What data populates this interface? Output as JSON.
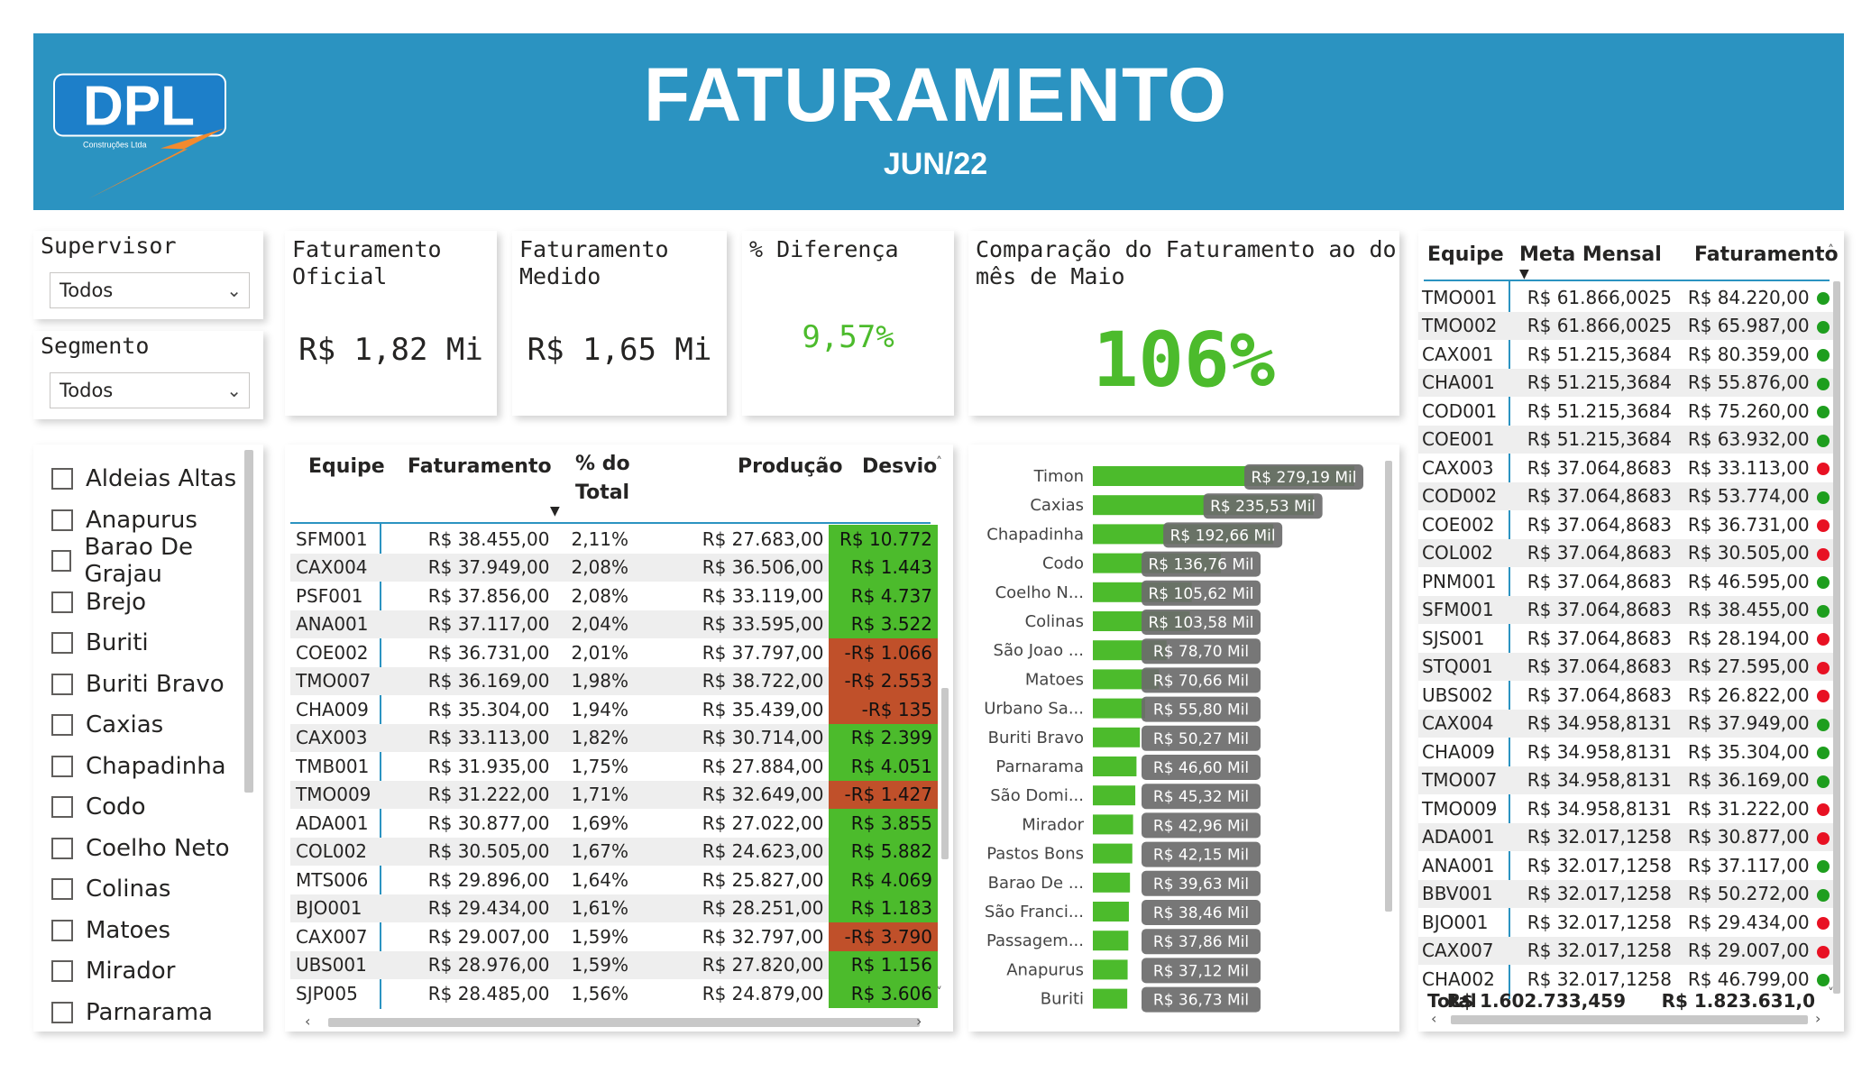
{
  "header": {
    "logo_text": "DPL",
    "logo_subtext": "Construções Ltda",
    "title": "FATURAMENTO",
    "subtitle": "JUN/22"
  },
  "filters": {
    "supervisor_label": "Supervisor",
    "supervisor_value": "Todos",
    "segmento_label": "Segmento",
    "segmento_value": "Todos"
  },
  "cities": [
    "Aldeias Altas",
    "Anapurus",
    "Barao De Grajau",
    "Brejo",
    "Buriti",
    "Buriti Bravo",
    "Caxias",
    "Chapadinha",
    "Codo",
    "Coelho Neto",
    "Colinas",
    "Matoes",
    "Mirador",
    "Parnarama"
  ],
  "kpis": {
    "oficial_label": "Faturamento\nOficial",
    "oficial_value": "R$ 1,82 Mi",
    "medido_label": "Faturamento\nMedido",
    "medido_value": "R$ 1,65 Mi",
    "diferenca_label": "% Diferença",
    "diferenca_value": "9,57%",
    "comparacao_label": "Comparação do Faturamento ao do\nmês de Maio",
    "comparacao_value": "106%"
  },
  "table1": {
    "headers": [
      "Equipe",
      "Faturamento",
      "% do\nTotal",
      "Produção",
      "Desvio"
    ],
    "rows": [
      {
        "equipe": "SFM001",
        "fat": "R$ 38.455,00",
        "pct": "2,11%",
        "prod": "R$ 27.683,00",
        "desvio": "R$ 10.772",
        "pos": true
      },
      {
        "equipe": "CAX004",
        "fat": "R$ 37.949,00",
        "pct": "2,08%",
        "prod": "R$ 36.506,00",
        "desvio": "R$ 1.443",
        "pos": true
      },
      {
        "equipe": "PSF001",
        "fat": "R$ 37.856,00",
        "pct": "2,08%",
        "prod": "R$ 33.119,00",
        "desvio": "R$ 4.737",
        "pos": true
      },
      {
        "equipe": "ANA001",
        "fat": "R$ 37.117,00",
        "pct": "2,04%",
        "prod": "R$ 33.595,00",
        "desvio": "R$ 3.522",
        "pos": true
      },
      {
        "equipe": "COE002",
        "fat": "R$ 36.731,00",
        "pct": "2,01%",
        "prod": "R$ 37.797,00",
        "desvio": "-R$ 1.066",
        "pos": false
      },
      {
        "equipe": "TMO007",
        "fat": "R$ 36.169,00",
        "pct": "1,98%",
        "prod": "R$ 38.722,00",
        "desvio": "-R$ 2.553",
        "pos": false
      },
      {
        "equipe": "CHA009",
        "fat": "R$ 35.304,00",
        "pct": "1,94%",
        "prod": "R$ 35.439,00",
        "desvio": "-R$ 135",
        "pos": false
      },
      {
        "equipe": "CAX003",
        "fat": "R$ 33.113,00",
        "pct": "1,82%",
        "prod": "R$ 30.714,00",
        "desvio": "R$ 2.399",
        "pos": true
      },
      {
        "equipe": "TMB001",
        "fat": "R$ 31.935,00",
        "pct": "1,75%",
        "prod": "R$ 27.884,00",
        "desvio": "R$ 4.051",
        "pos": true
      },
      {
        "equipe": "TMO009",
        "fat": "R$ 31.222,00",
        "pct": "1,71%",
        "prod": "R$ 32.649,00",
        "desvio": "-R$ 1.427",
        "pos": false
      },
      {
        "equipe": "ADA001",
        "fat": "R$ 30.877,00",
        "pct": "1,69%",
        "prod": "R$ 27.022,00",
        "desvio": "R$ 3.855",
        "pos": true
      },
      {
        "equipe": "COL002",
        "fat": "R$ 30.505,00",
        "pct": "1,67%",
        "prod": "R$ 24.623,00",
        "desvio": "R$ 5.882",
        "pos": true
      },
      {
        "equipe": "MTS006",
        "fat": "R$ 29.896,00",
        "pct": "1,64%",
        "prod": "R$ 25.827,00",
        "desvio": "R$ 4.069",
        "pos": true
      },
      {
        "equipe": "BJO001",
        "fat": "R$ 29.434,00",
        "pct": "1,61%",
        "prod": "R$ 28.251,00",
        "desvio": "R$ 1.183",
        "pos": true
      },
      {
        "equipe": "CAX007",
        "fat": "R$ 29.007,00",
        "pct": "1,59%",
        "prod": "R$ 32.797,00",
        "desvio": "-R$ 3.790",
        "pos": false
      },
      {
        "equipe": "UBS001",
        "fat": "R$ 28.976,00",
        "pct": "1,59%",
        "prod": "R$ 27.820,00",
        "desvio": "R$ 1.156",
        "pos": true
      },
      {
        "equipe": "SJP005",
        "fat": "R$ 28.485,00",
        "pct": "1,56%",
        "prod": "R$ 24.879,00",
        "desvio": "R$ 3.606",
        "pos": true
      }
    ]
  },
  "chart_data": {
    "type": "bar",
    "orientation": "horizontal",
    "categories": [
      "Timon",
      "Caxias",
      "Chapadinha",
      "Codo",
      "Coelho N...",
      "Colinas",
      "São Joao ...",
      "Matoes",
      "Urbano Sa...",
      "Buriti Bravo",
      "Parnarama",
      "São Domi...",
      "Mirador",
      "Pastos Bons",
      "Barao De ...",
      "São Franci...",
      "Passagem...",
      "Anapurus",
      "Buriti"
    ],
    "values": [
      279.19,
      235.53,
      192.66,
      136.76,
      105.62,
      103.58,
      78.7,
      70.66,
      55.8,
      50.27,
      46.6,
      45.32,
      42.96,
      42.15,
      39.63,
      38.46,
      37.86,
      37.12,
      36.73
    ],
    "data_labels": [
      "R$ 279,19 Mil",
      "R$ 235,53 Mil",
      "R$ 192,66 Mil",
      "R$ 136,76 Mil",
      "R$ 105,62 Mil",
      "R$ 103,58 Mil",
      "R$ 78,70 Mil",
      "R$ 70,66 Mil",
      "R$ 55,80 Mil",
      "R$ 50,27 Mil",
      "R$ 46,60 Mil",
      "R$ 45,32 Mil",
      "R$ 42,96 Mil",
      "R$ 42,15 Mil",
      "R$ 39,63 Mil",
      "R$ 38,46 Mil",
      "R$ 37,86 Mil",
      "R$ 37,12 Mil",
      "R$ 36,73 Mil"
    ],
    "bar_color": "#4cbb2c"
  },
  "table2": {
    "headers": [
      "Equipe",
      "Meta Mensal",
      "Faturamento"
    ],
    "rows": [
      {
        "equipe": "TMO001",
        "meta": "R$ 61.866,0025",
        "fat": "R$ 84.220,00",
        "ok": true
      },
      {
        "equipe": "TMO002",
        "meta": "R$ 61.866,0025",
        "fat": "R$ 65.987,00",
        "ok": true
      },
      {
        "equipe": "CAX001",
        "meta": "R$ 51.215,3684",
        "fat": "R$ 80.359,00",
        "ok": true
      },
      {
        "equipe": "CHA001",
        "meta": "R$ 51.215,3684",
        "fat": "R$ 55.876,00",
        "ok": true
      },
      {
        "equipe": "COD001",
        "meta": "R$ 51.215,3684",
        "fat": "R$ 75.260,00",
        "ok": true
      },
      {
        "equipe": "COE001",
        "meta": "R$ 51.215,3684",
        "fat": "R$ 63.932,00",
        "ok": true
      },
      {
        "equipe": "CAX003",
        "meta": "R$ 37.064,8683",
        "fat": "R$ 33.113,00",
        "ok": false
      },
      {
        "equipe": "COD002",
        "meta": "R$ 37.064,8683",
        "fat": "R$ 53.774,00",
        "ok": true
      },
      {
        "equipe": "COE002",
        "meta": "R$ 37.064,8683",
        "fat": "R$ 36.731,00",
        "ok": false
      },
      {
        "equipe": "COL002",
        "meta": "R$ 37.064,8683",
        "fat": "R$ 30.505,00",
        "ok": false
      },
      {
        "equipe": "PNM001",
        "meta": "R$ 37.064,8683",
        "fat": "R$ 46.595,00",
        "ok": true
      },
      {
        "equipe": "SFM001",
        "meta": "R$ 37.064,8683",
        "fat": "R$ 38.455,00",
        "ok": true
      },
      {
        "equipe": "SJS001",
        "meta": "R$ 37.064,8683",
        "fat": "R$ 28.194,00",
        "ok": false
      },
      {
        "equipe": "STQ001",
        "meta": "R$ 37.064,8683",
        "fat": "R$ 27.595,00",
        "ok": false
      },
      {
        "equipe": "UBS002",
        "meta": "R$ 37.064,8683",
        "fat": "R$ 26.822,00",
        "ok": false
      },
      {
        "equipe": "CAX004",
        "meta": "R$ 34.958,8131",
        "fat": "R$ 37.949,00",
        "ok": true
      },
      {
        "equipe": "CHA009",
        "meta": "R$ 34.958,8131",
        "fat": "R$ 35.304,00",
        "ok": true
      },
      {
        "equipe": "TMO007",
        "meta": "R$ 34.958,8131",
        "fat": "R$ 36.169,00",
        "ok": true
      },
      {
        "equipe": "TMO009",
        "meta": "R$ 34.958,8131",
        "fat": "R$ 31.222,00",
        "ok": false
      },
      {
        "equipe": "ADA001",
        "meta": "R$ 32.017,1258",
        "fat": "R$ 30.877,00",
        "ok": false
      },
      {
        "equipe": "ANA001",
        "meta": "R$ 32.017,1258",
        "fat": "R$ 37.117,00",
        "ok": true
      },
      {
        "equipe": "BBV001",
        "meta": "R$ 32.017,1258",
        "fat": "R$ 50.272,00",
        "ok": true
      },
      {
        "equipe": "BJO001",
        "meta": "R$ 32.017,1258",
        "fat": "R$ 29.434,00",
        "ok": false
      },
      {
        "equipe": "CAX007",
        "meta": "R$ 32.017,1258",
        "fat": "R$ 29.007,00",
        "ok": false
      },
      {
        "equipe": "CHA002",
        "meta": "R$ 32.017,1258",
        "fat": "R$ 46.799,00",
        "ok": true
      }
    ],
    "total_label": "Total",
    "total_meta": "R$ 1.602.733,459",
    "total_fat": "R$ 1.823.631,0"
  },
  "colors": {
    "header_blue": "#2b93c1",
    "green": "#4cbb2c",
    "red": "#c0502a",
    "dot_green": "#1e9e1e",
    "dot_red": "#e81123",
    "kpi_green": "#4cbb2c"
  }
}
